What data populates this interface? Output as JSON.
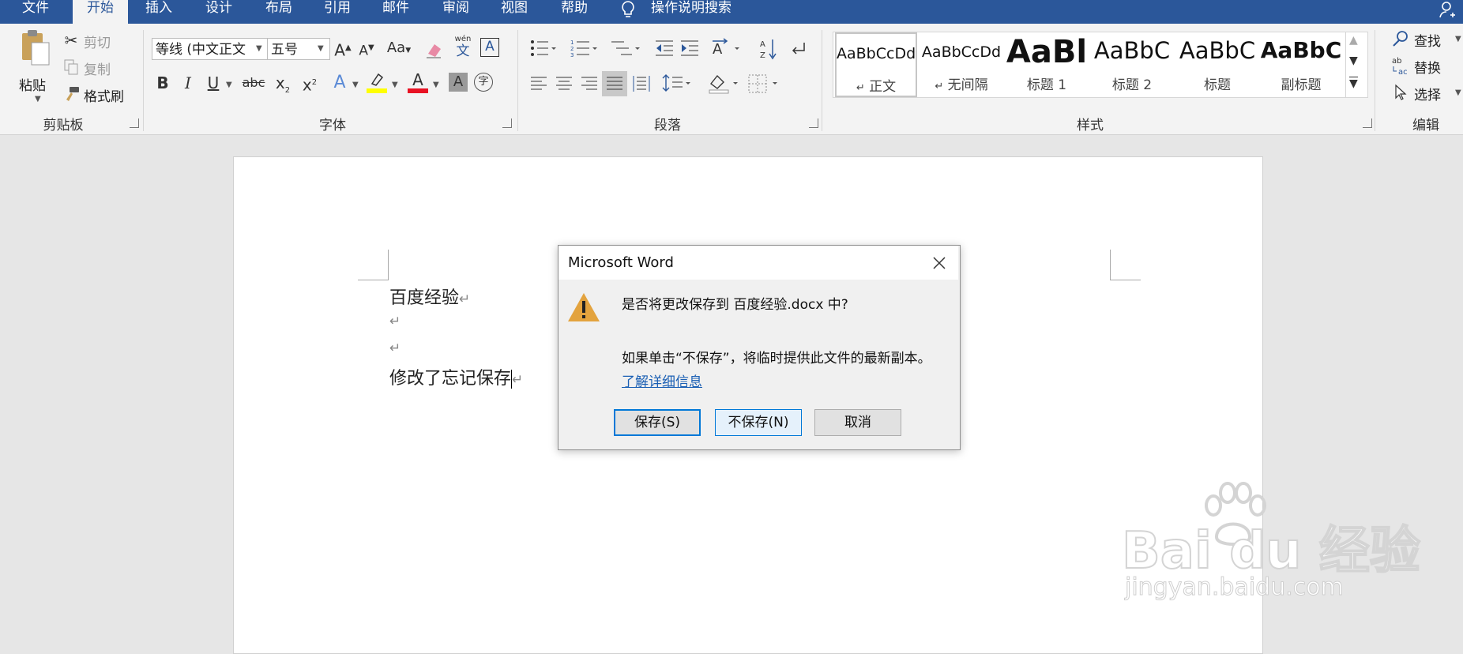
{
  "menu": {
    "tabs": [
      "文件",
      "开始",
      "插入",
      "设计",
      "布局",
      "引用",
      "邮件",
      "审阅",
      "视图",
      "帮助"
    ],
    "active_index": 1,
    "search_label": "操作说明搜索"
  },
  "ribbon": {
    "clipboard": {
      "group_label": "剪贴板",
      "paste": "粘贴",
      "cut": "剪切",
      "copy": "复制",
      "format_painter": "格式刷"
    },
    "font": {
      "group_label": "字体",
      "font_name": "等线 (中文正文",
      "font_size": "五号",
      "grow": "A",
      "shrink": "A",
      "change_case": "Aa",
      "bold": "B",
      "italic": "I",
      "underline": "U",
      "strike": "abc",
      "subscript": "x",
      "subscript_mark": "2",
      "superscript": "x",
      "superscript_mark": "2",
      "text_effect": "A",
      "font_color": "A",
      "char_shading": "A",
      "phonetic": "wén",
      "phonetic_char": "文",
      "border_char": "A",
      "enclose": "字"
    },
    "paragraph": {
      "group_label": "段落"
    },
    "styles": {
      "group_label": "样式",
      "items": [
        {
          "sample": "AaBbCcDd",
          "name": "正文",
          "mark": "↵"
        },
        {
          "sample": "AaBbCcDd",
          "name": "无间隔",
          "mark": "↵"
        },
        {
          "sample": "AaBl",
          "name": "标题 1",
          "mark": ""
        },
        {
          "sample": "AaBbC",
          "name": "标题 2",
          "mark": ""
        },
        {
          "sample": "AaBbC",
          "name": "标题",
          "mark": ""
        },
        {
          "sample": "AaBbC",
          "name": "副标题",
          "mark": ""
        }
      ]
    },
    "editing": {
      "group_label": "编辑",
      "find": "查找",
      "replace": "替换",
      "select": "选择"
    }
  },
  "document": {
    "lines": [
      "百度经验",
      "",
      "",
      "修改了忘记保存"
    ],
    "para_mark": "↵"
  },
  "dialog": {
    "title": "Microsoft Word",
    "message": "是否将更改保存到 百度经验.docx 中?",
    "detail": "如果单击“不保存”，将临时提供此文件的最新副本。",
    "link": "了解详细信息",
    "buttons": {
      "save": "保存(S)",
      "dont_save": "不保存(N)",
      "cancel": "取消"
    }
  },
  "watermark": {
    "logo": "Bai du 经验",
    "url": "jingyan.baidu.com"
  },
  "colors": {
    "brand_blue": "#2b579a",
    "focus_blue": "#0078d7",
    "link_blue": "#1a5fb4",
    "warning_amber": "#e3a33e",
    "font_color_red": "#e81123",
    "highlight_yellow": "#ffff00"
  }
}
